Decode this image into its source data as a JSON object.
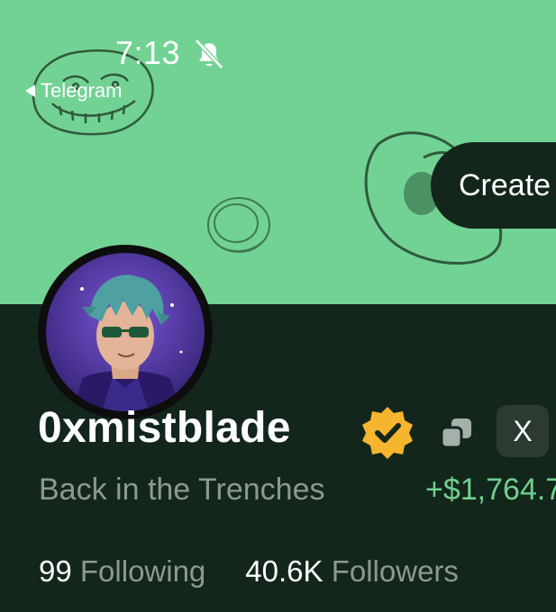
{
  "status_bar": {
    "time": "7:13",
    "back_label": "Telegram"
  },
  "banner": {
    "create_label": "Create"
  },
  "profile": {
    "username": "0xmistblade",
    "bio": "Back in the Trenches",
    "pnl": "+$1,764.7",
    "x_label": "X",
    "following_count": "99",
    "following_label": "Following",
    "followers_count": "40.6K",
    "followers_label": "Followers"
  },
  "colors": {
    "banner": "#72d293",
    "background": "#13261b",
    "pnl": "#6fd08e",
    "verified": "#f5b52e",
    "muted_text": "#8b9a91"
  },
  "icons": [
    "bell-slash-icon",
    "back-arrow-icon",
    "verified-badge-icon",
    "copy-icon",
    "x-logo-icon"
  ]
}
